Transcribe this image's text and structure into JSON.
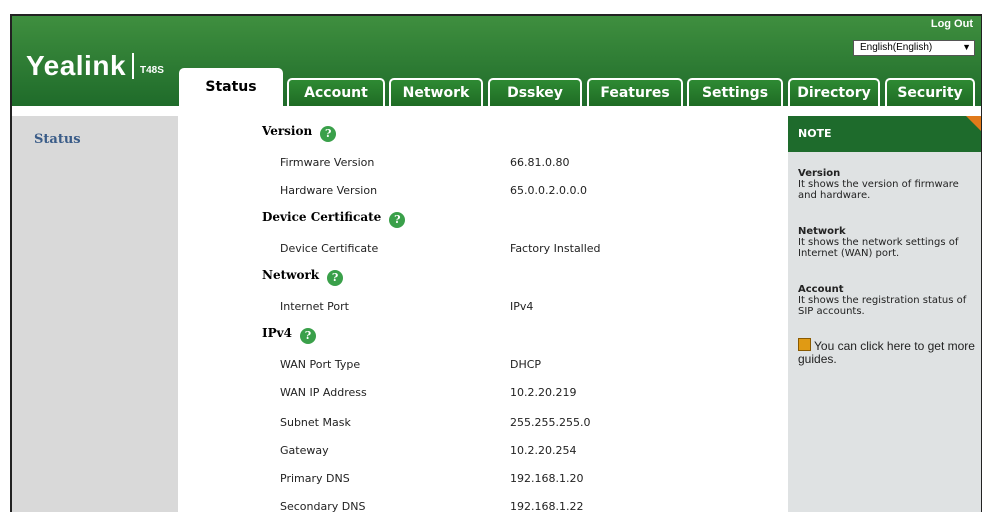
{
  "header": {
    "brand": "Yealink",
    "model": "T48S",
    "logout": "Log Out",
    "language": "English(English)"
  },
  "tabs": [
    {
      "label": "Status"
    },
    {
      "label": "Account"
    },
    {
      "label": "Network"
    },
    {
      "label": "Dsskey"
    },
    {
      "label": "Features"
    },
    {
      "label": "Settings"
    },
    {
      "label": "Directory"
    },
    {
      "label": "Security"
    }
  ],
  "sidebar": {
    "items": [
      {
        "label": "Status"
      }
    ]
  },
  "content": {
    "sections": {
      "version": "Version",
      "certificate": "Device Certificate",
      "network": "Network",
      "ipv4": "IPv4"
    },
    "rows": {
      "firmware": {
        "label": "Firmware Version",
        "value": "66.81.0.80"
      },
      "hardware": {
        "label": "Hardware Version",
        "value": "65.0.0.2.0.0.0"
      },
      "device_cert": {
        "label": "Device Certificate",
        "value": "Factory Installed"
      },
      "internet_port": {
        "label": "Internet Port",
        "value": "IPv4"
      },
      "wan_type": {
        "label": "WAN Port Type",
        "value": "DHCP"
      },
      "wan_ip": {
        "label": "WAN IP Address",
        "value": "10.2.20.219"
      },
      "subnet": {
        "label": "Subnet Mask",
        "value": "255.255.255.0"
      },
      "gateway": {
        "label": "Gateway",
        "value": "10.2.20.254"
      },
      "primary_dns": {
        "label": "Primary DNS",
        "value": "192.168.1.20"
      },
      "secondary_dns": {
        "label": "Secondary DNS",
        "value": "192.168.1.22"
      }
    }
  },
  "note": {
    "title": "NOTE",
    "items": [
      {
        "title": "Version",
        "text": "It shows the version of firmware and hardware."
      },
      {
        "title": "Network",
        "text": "It shows the network settings of Internet (WAN) port."
      },
      {
        "title": "Account",
        "text": "It shows the registration status of SIP accounts."
      }
    ],
    "guide": "You can click here to get more guides."
  },
  "colors": {
    "header_green": "#1f6b2a",
    "help_green": "#3aa04a",
    "sidebar_gray": "#d9d9d9",
    "note_orange": "#e07a1a"
  }
}
